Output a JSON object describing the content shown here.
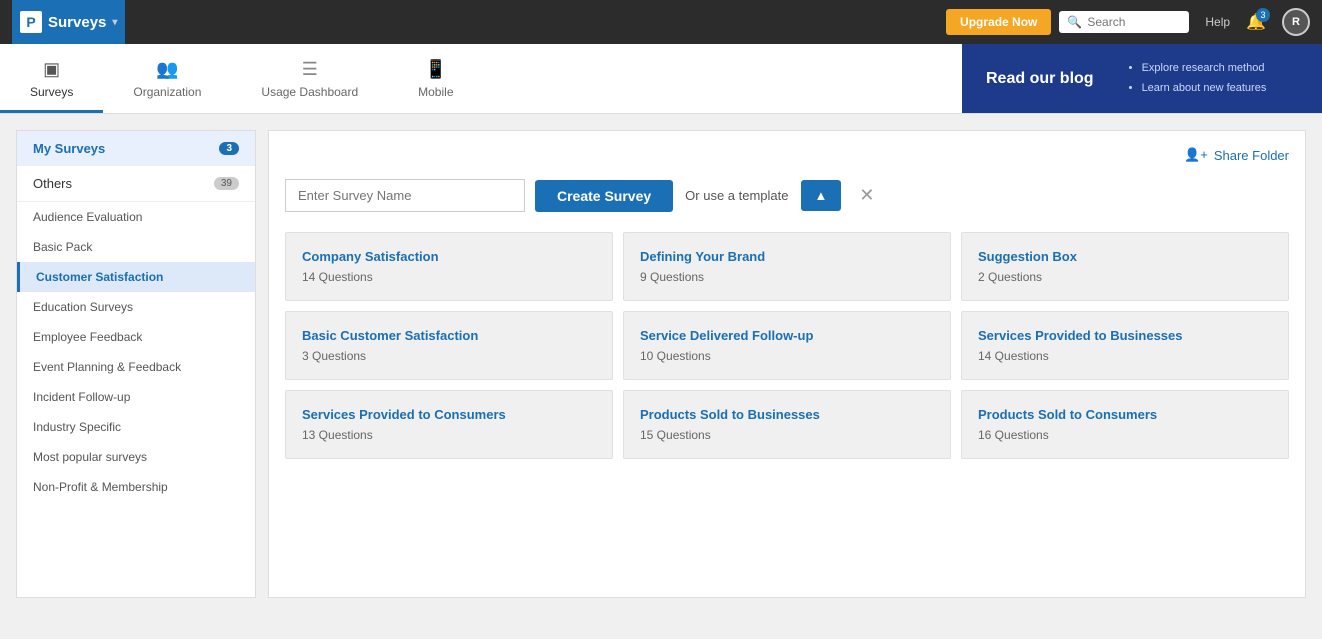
{
  "topNav": {
    "brandName": "Surveys",
    "upgradeLabel": "Upgrade Now",
    "searchPlaceholder": "Search",
    "helpLabel": "Help",
    "bellCount": "3",
    "userInitial": "R"
  },
  "secNav": {
    "tabs": [
      {
        "id": "surveys",
        "label": "Surveys",
        "icon": "▣",
        "active": true
      },
      {
        "id": "organization",
        "label": "Organization",
        "icon": "👥",
        "active": false
      },
      {
        "id": "usage-dashboard",
        "label": "Usage Dashboard",
        "icon": "☰",
        "active": false
      },
      {
        "id": "mobile",
        "label": "Mobile",
        "icon": "📱",
        "active": false
      }
    ],
    "blogBanner": {
      "title": "Read our blog",
      "bullets": [
        "Explore research method",
        "Learn about new features"
      ]
    }
  },
  "sidebar": {
    "sections": [
      {
        "items": [
          {
            "label": "My Surveys",
            "count": "3",
            "active": true
          },
          {
            "label": "Others",
            "count": "39",
            "active": false
          }
        ]
      }
    ],
    "subItems": [
      {
        "label": "Audience Evaluation",
        "active": false
      },
      {
        "label": "Basic Pack",
        "active": false
      },
      {
        "label": "Customer Satisfaction",
        "active": true
      },
      {
        "label": "Education Surveys",
        "active": false
      },
      {
        "label": "Employee Feedback",
        "active": false
      },
      {
        "label": "Event Planning & Feedback",
        "active": false
      },
      {
        "label": "Incident Follow-up",
        "active": false
      },
      {
        "label": "Industry Specific",
        "active": false
      },
      {
        "label": "Most popular surveys",
        "active": false
      },
      {
        "label": "Non-Profit & Membership",
        "active": false
      }
    ]
  },
  "content": {
    "shareFolder": "Share Folder",
    "surveyNamePlaceholder": "Enter Survey Name",
    "createSurveyLabel": "Create Survey",
    "orDivider": "Or use a template",
    "templates": [
      {
        "title": "Company Satisfaction",
        "sub": "14 Questions"
      },
      {
        "title": "Defining Your Brand",
        "sub": "9 Questions"
      },
      {
        "title": "Suggestion Box",
        "sub": "2 Questions"
      },
      {
        "title": "Basic Customer Satisfaction",
        "sub": "3 Questions"
      },
      {
        "title": "Service Delivered Follow-up",
        "sub": "10 Questions"
      },
      {
        "title": "Services Provided to Businesses",
        "sub": "14 Questions"
      },
      {
        "title": "Services Provided to Consumers",
        "sub": "13 Questions"
      },
      {
        "title": "Products Sold to Businesses",
        "sub": "15 Questions"
      },
      {
        "title": "Products Sold to Consumers",
        "sub": "16 Questions"
      }
    ]
  }
}
